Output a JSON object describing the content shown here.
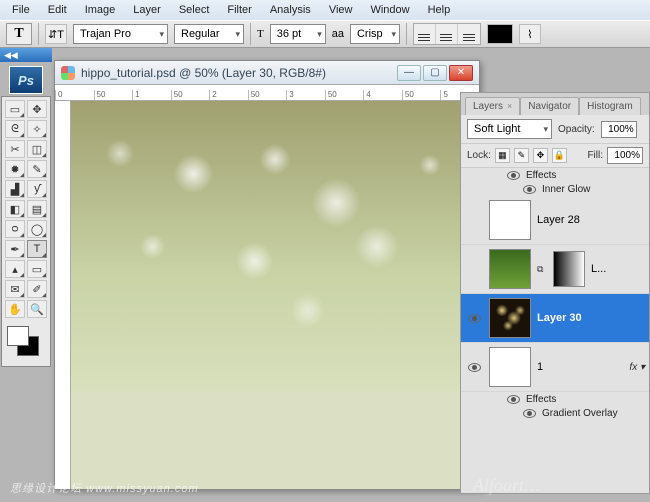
{
  "menu": [
    "File",
    "Edit",
    "Image",
    "Layer",
    "Select",
    "Filter",
    "Analysis",
    "View",
    "Window",
    "Help"
  ],
  "options": {
    "tool_glyph": "T",
    "font_family": "Trajan Pro",
    "font_style": "Regular",
    "font_size": "36 pt",
    "aa_label": "aa",
    "aa_mode": "Crisp"
  },
  "doc": {
    "title": "hippo_tutorial.psd @ 50% (Layer 30, RGB/8#)",
    "ruler_marks": [
      "0",
      "50",
      "1",
      "50",
      "2",
      "50",
      "3",
      "50",
      "4",
      "50",
      "5"
    ]
  },
  "panel": {
    "tabs": [
      "Layers",
      "Navigator",
      "Histogram"
    ],
    "blend_mode": "Soft Light",
    "opacity_label": "Opacity:",
    "opacity": "100%",
    "lock_label": "Lock:",
    "fill_label": "Fill:",
    "fill": "100%",
    "effects_label": "Effects",
    "layers": [
      {
        "effect_of_prev": true,
        "effect_name": "Inner Glow"
      },
      {
        "name": "Layer 28",
        "visible": false,
        "thumb": "white"
      },
      {
        "name": "L...",
        "visible": false,
        "thumb": "green",
        "mask": true
      },
      {
        "name": "Layer 30",
        "visible": true,
        "thumb": "bokeh",
        "selected": true
      },
      {
        "name": "1",
        "visible": true,
        "thumb": "white",
        "fx": true,
        "effects": [
          "Gradient Overlay"
        ]
      }
    ]
  },
  "watermark1": "思缘设计论坛  www.missyuan.com",
  "watermark2": "Alfoart…"
}
